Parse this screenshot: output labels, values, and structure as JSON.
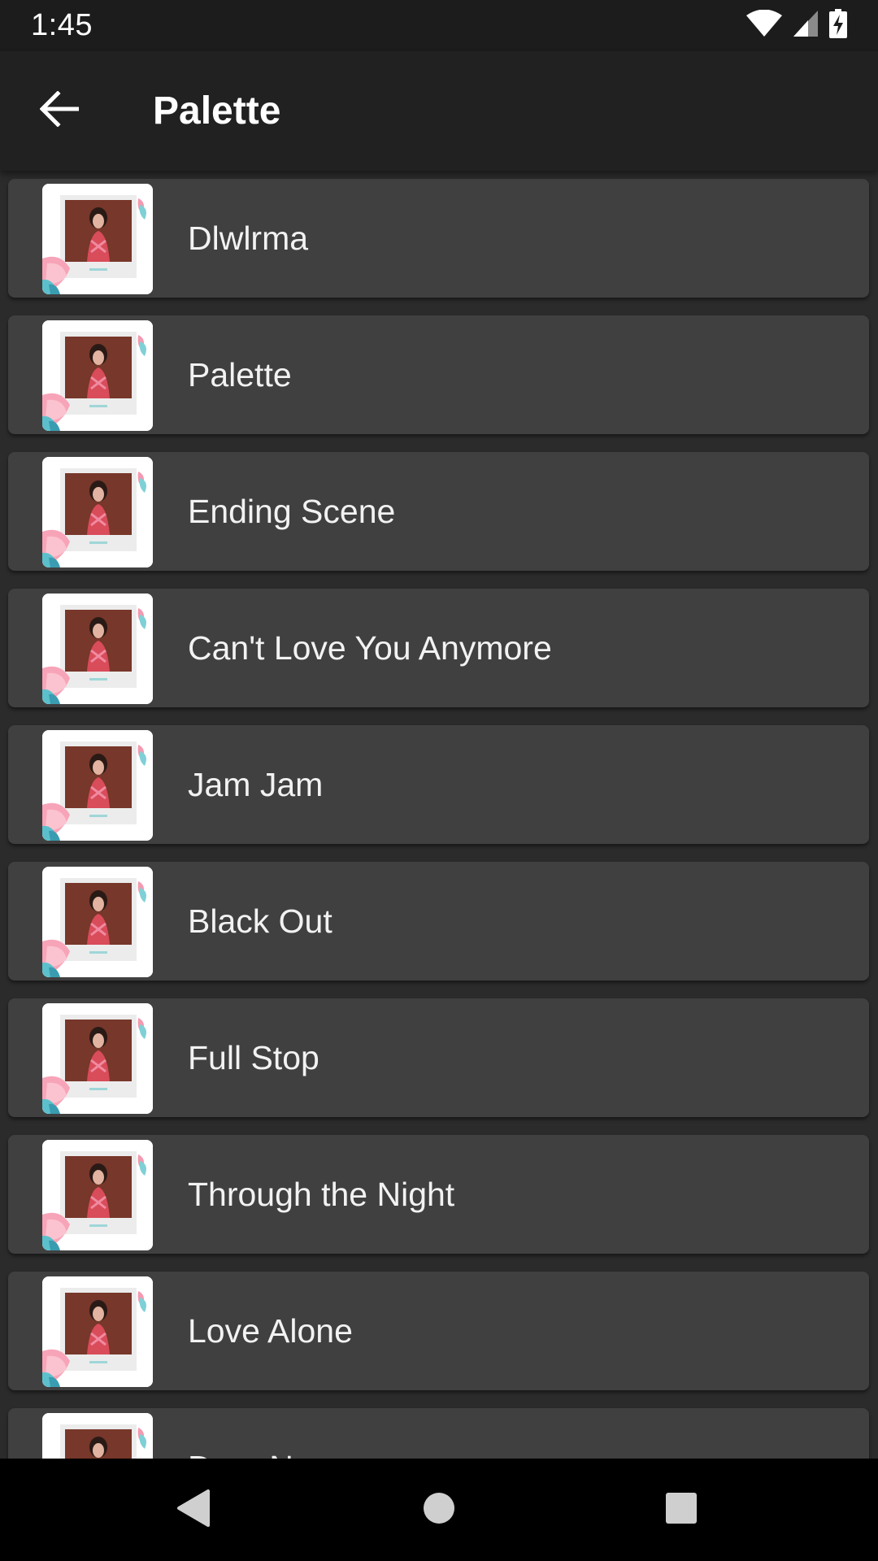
{
  "status_bar": {
    "time": "1:45",
    "icons": [
      "wifi-icon",
      "cell-signal-icon",
      "battery-charging-icon"
    ]
  },
  "app_bar": {
    "back_icon": "arrow-back-icon",
    "title": "Palette"
  },
  "tracks": [
    {
      "title": "Dlwlrma"
    },
    {
      "title": "Palette"
    },
    {
      "title": "Ending Scene"
    },
    {
      "title": "Can't Love You Anymore"
    },
    {
      "title": "Jam Jam"
    },
    {
      "title": "Black Out"
    },
    {
      "title": "Full Stop"
    },
    {
      "title": "Through the Night"
    },
    {
      "title": "Love Alone"
    },
    {
      "title": "Dear Name"
    }
  ],
  "nav_bar": {
    "buttons": [
      "nav-back-icon",
      "nav-home-icon",
      "nav-recents-icon"
    ]
  },
  "colors": {
    "background": "#2b2b2b",
    "card": "#404040",
    "app_bar": "#212121",
    "status_bar": "#1c1c1c",
    "nav_bar": "#000000"
  }
}
